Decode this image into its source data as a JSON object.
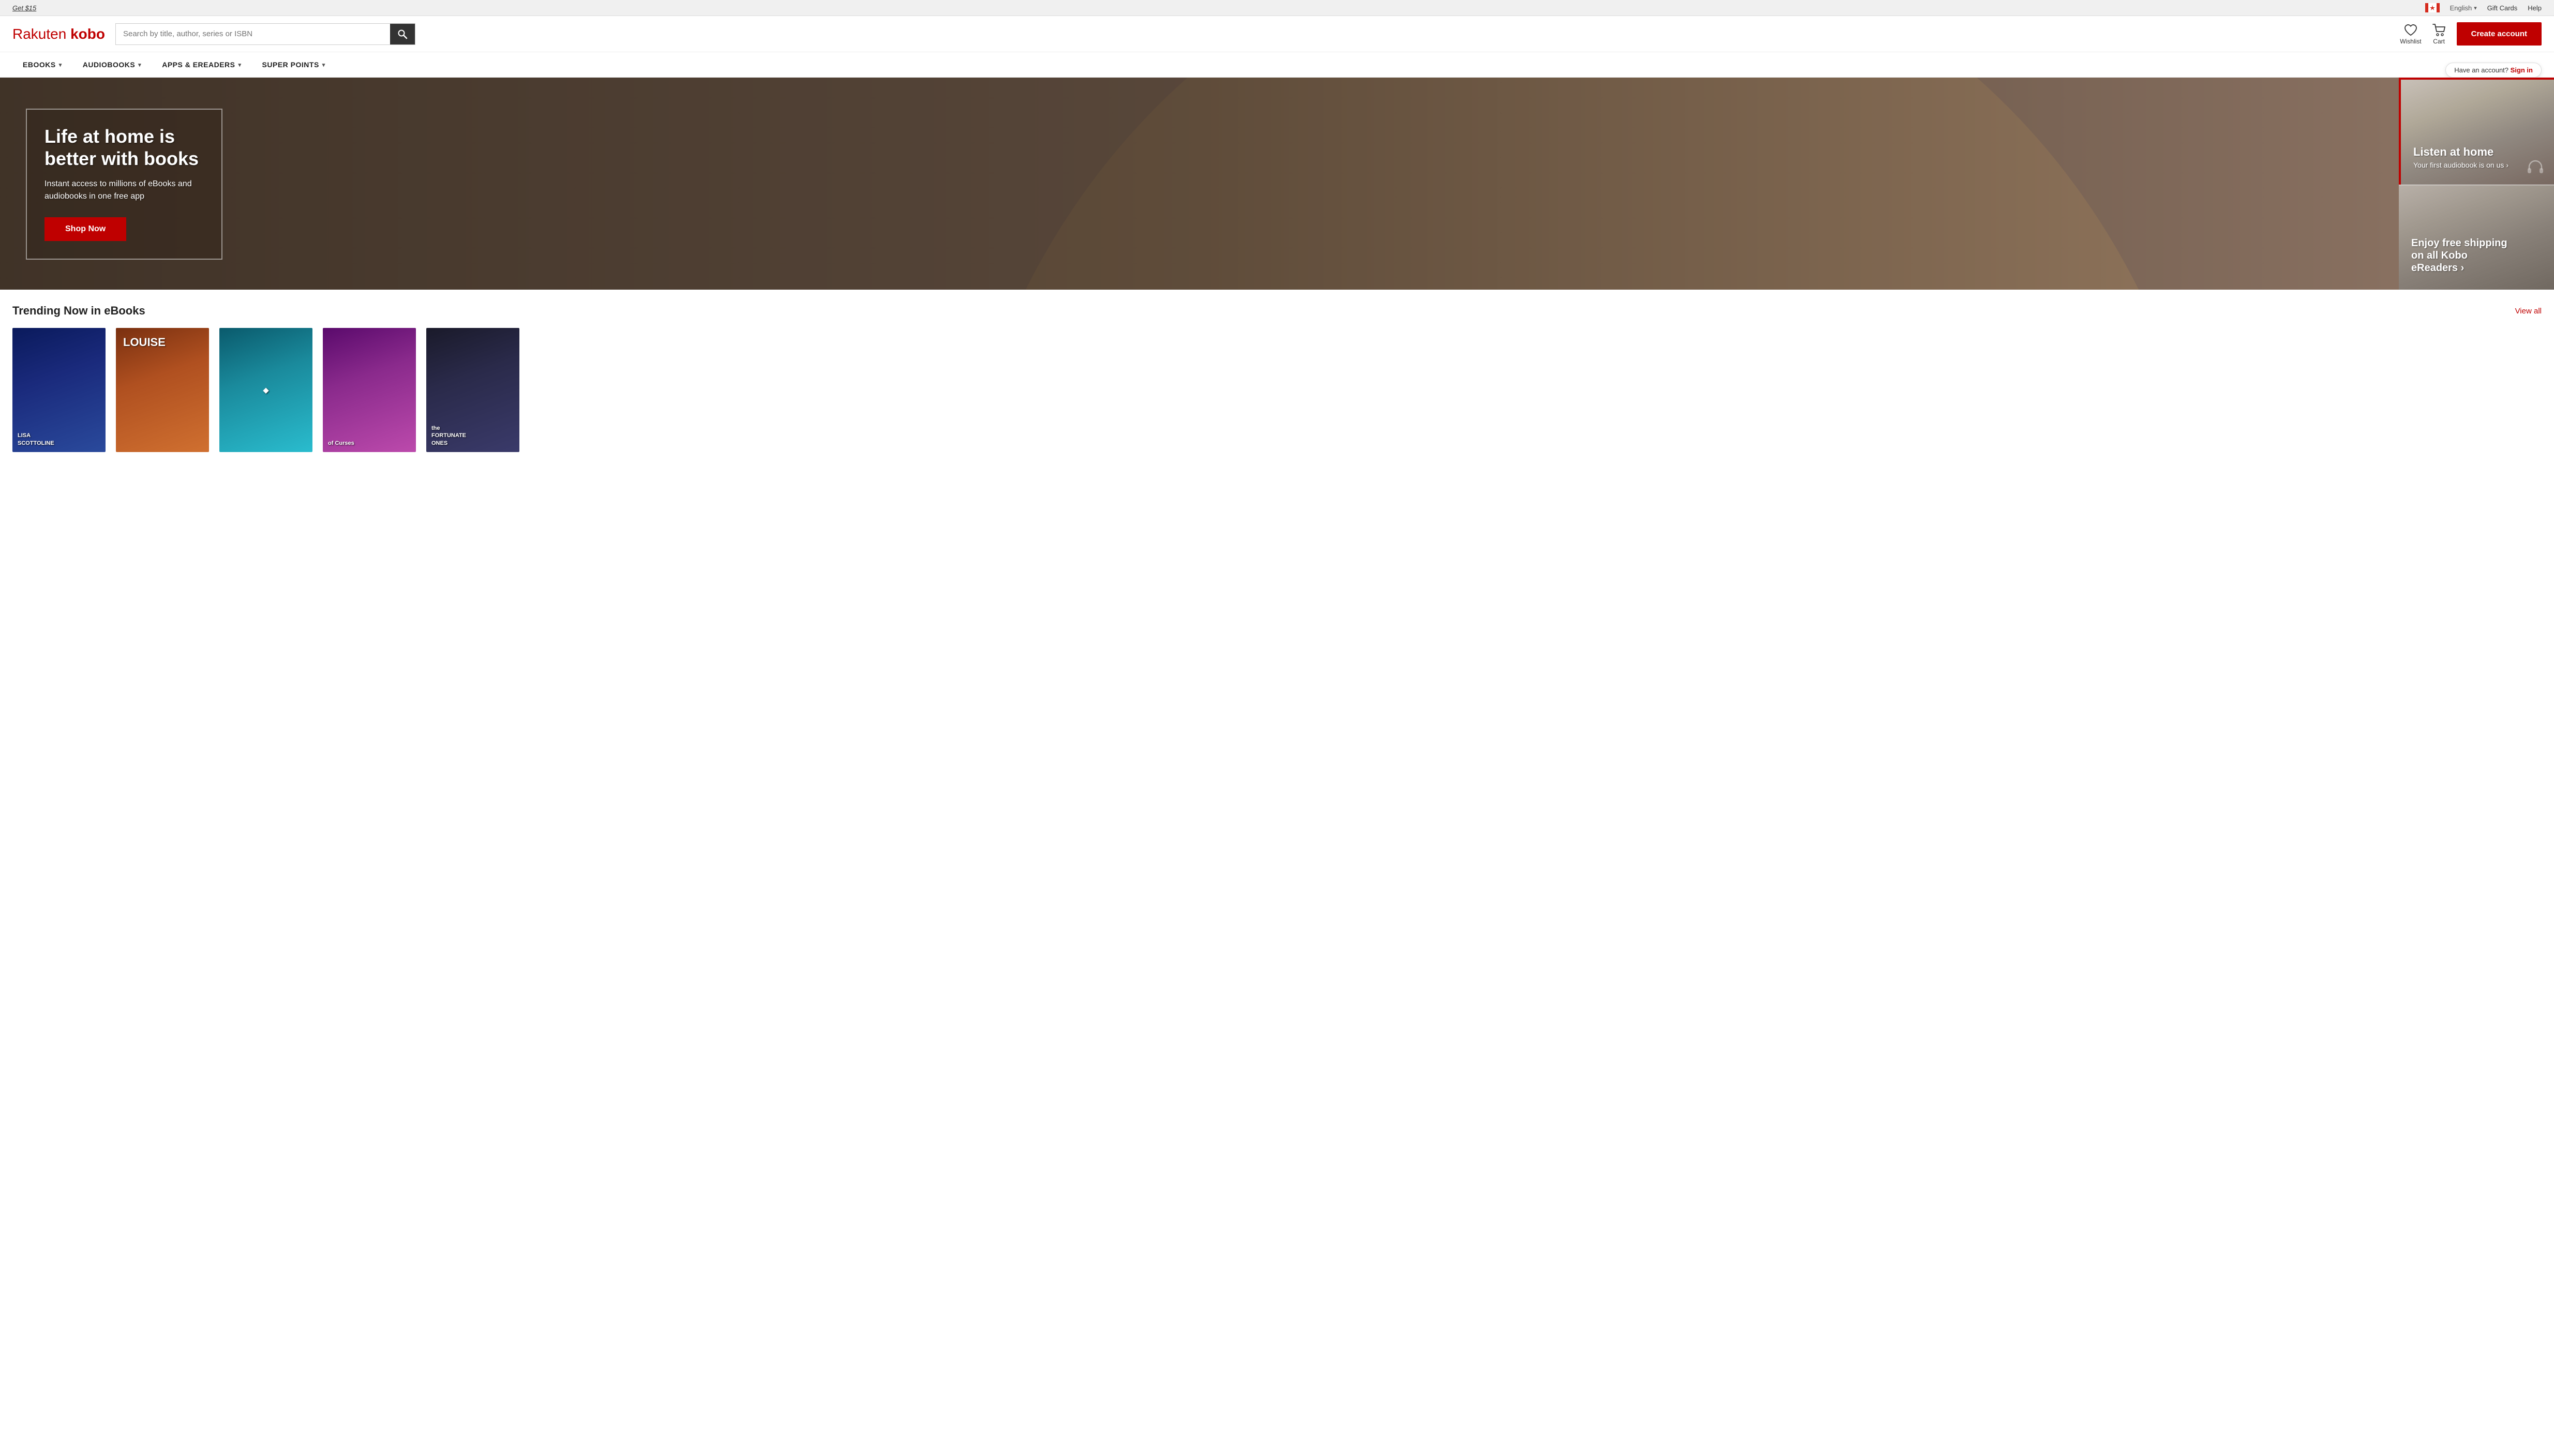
{
  "topbar": {
    "promo_text": "Get $15",
    "promo_link": "Get $15",
    "language": "English",
    "gift_cards": "Gift Cards",
    "help": "Help"
  },
  "header": {
    "logo": "Rakuten kobo",
    "search_placeholder": "Search by title, author, series or ISBN",
    "wishlist_label": "Wishlist",
    "cart_label": "Cart",
    "create_account": "Create account",
    "have_account": "Have an account?",
    "sign_in": "Sign in"
  },
  "nav": {
    "items": [
      {
        "label": "eBOOKS",
        "has_dropdown": true
      },
      {
        "label": "AUDIOBOOKS",
        "has_dropdown": true
      },
      {
        "label": "APPS & eREADERS",
        "has_dropdown": true
      },
      {
        "label": "SUPER POINTS",
        "has_dropdown": true
      }
    ]
  },
  "hero": {
    "main": {
      "title": "Life at home is better with books",
      "subtitle": "Instant access to millions of eBooks and audiobooks in one free app",
      "cta": "Shop Now"
    },
    "aside_top": {
      "title": "Listen at home",
      "subtitle": "Your first audiobook is on us",
      "has_arrow": true
    },
    "aside_bottom": {
      "title": "Enjoy free shipping on all Kobo eReaders",
      "has_arrow": true
    }
  },
  "trending": {
    "title": "Trending Now in eBooks",
    "view_all": "View all",
    "books": [
      {
        "author": "Lisa Scottoline",
        "color_class": "book-cover-1"
      },
      {
        "author": "Louise",
        "color_class": "book-cover-2"
      },
      {
        "author": "",
        "color_class": "book-cover-3"
      },
      {
        "author": "of Curses",
        "color_class": "book-cover-4"
      },
      {
        "author": "The Fortunate Ones",
        "color_class": "book-cover-5"
      }
    ]
  },
  "colors": {
    "brand_red": "#bf0000",
    "nav_bg": "#f0f0f0"
  }
}
